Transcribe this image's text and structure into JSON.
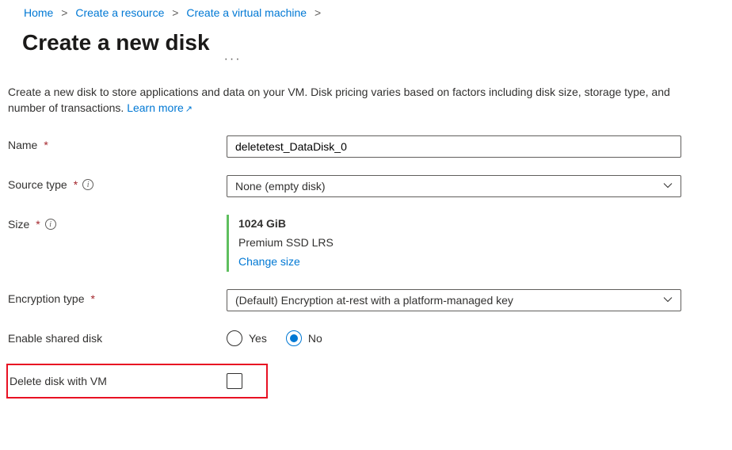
{
  "breadcrumb": {
    "items": [
      "Home",
      "Create a resource",
      "Create a virtual machine"
    ]
  },
  "title": "Create a new disk",
  "intro": {
    "text": "Create a new disk to store applications and data on your VM. Disk pricing varies based on factors including disk size, storage type, and number of transactions. ",
    "link": "Learn more"
  },
  "form": {
    "name": {
      "label": "Name",
      "value": "deletetest_DataDisk_0"
    },
    "sourceType": {
      "label": "Source type",
      "selected": "None (empty disk)"
    },
    "size": {
      "label": "Size",
      "value": "1024 GiB",
      "tier": "Premium SSD LRS",
      "change": "Change size"
    },
    "encryption": {
      "label": "Encryption type",
      "selected": "(Default) Encryption at-rest with a platform-managed key"
    },
    "sharedDisk": {
      "label": "Enable shared disk",
      "yes": "Yes",
      "no": "No"
    },
    "deleteWithVm": {
      "label": "Delete disk with VM"
    }
  }
}
